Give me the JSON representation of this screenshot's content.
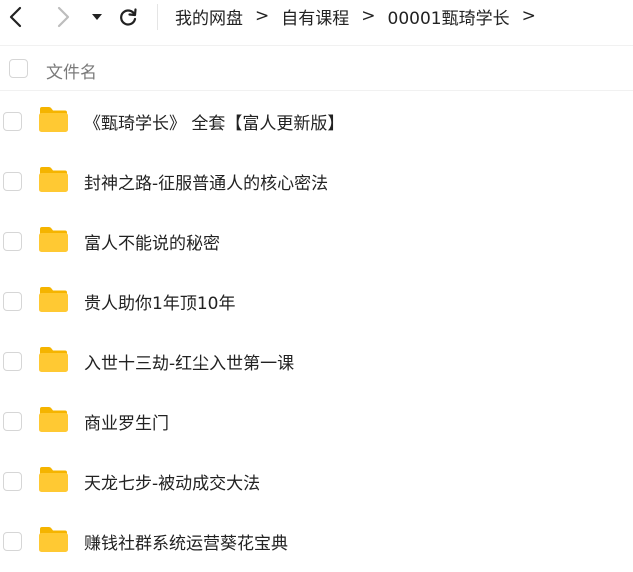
{
  "toolbar": {
    "icons": {
      "back": "chevron-left-icon",
      "forward": "chevron-right-icon",
      "history": "caret-down-icon",
      "refresh": "refresh-icon"
    },
    "breadcrumb": [
      "我的网盘",
      "自有课程",
      "00001甄琦学长"
    ],
    "separator": ">"
  },
  "list_header": {
    "column_label": "文件名"
  },
  "files": [
    {
      "name": "《甄琦学长》 全套【富人更新版】",
      "icon": "folder-icon"
    },
    {
      "name": "封神之路-征服普通人的核心密法",
      "icon": "folder-icon"
    },
    {
      "name": "富人不能说的秘密",
      "icon": "folder-icon"
    },
    {
      "name": "贵人助你1年顶10年",
      "icon": "folder-icon"
    },
    {
      "name": "入世十三劫-红尘入世第一课",
      "icon": "folder-icon"
    },
    {
      "name": "商业罗生门",
      "icon": "folder-icon"
    },
    {
      "name": "天龙七步-被动成交大法",
      "icon": "folder-icon"
    },
    {
      "name": "赚钱社群系统运营葵花宝典",
      "icon": "folder-icon"
    }
  ],
  "colors": {
    "folder_body": "#FFC933",
    "folder_tab": "#F5B400",
    "text": "#222222",
    "muted": "#7a7a7a",
    "disabled_icon": "#bdbdbd"
  }
}
